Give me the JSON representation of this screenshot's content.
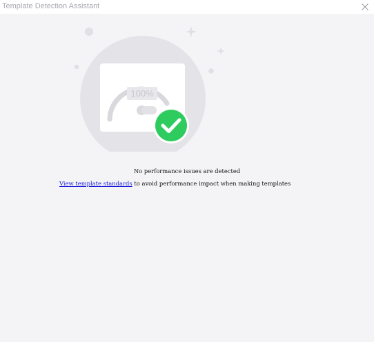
{
  "window": {
    "title": "Template Detection Assistant"
  },
  "illustration": {
    "gauge_text": "100%"
  },
  "result": {
    "message": "No performance issues are detected",
    "link_label": "View template standards",
    "hint_suffix": " to avoid performance impact when making templates"
  },
  "colors": {
    "background": "#f4f4f7",
    "success": "#2ecc5e",
    "link": "#1a1ad8"
  }
}
